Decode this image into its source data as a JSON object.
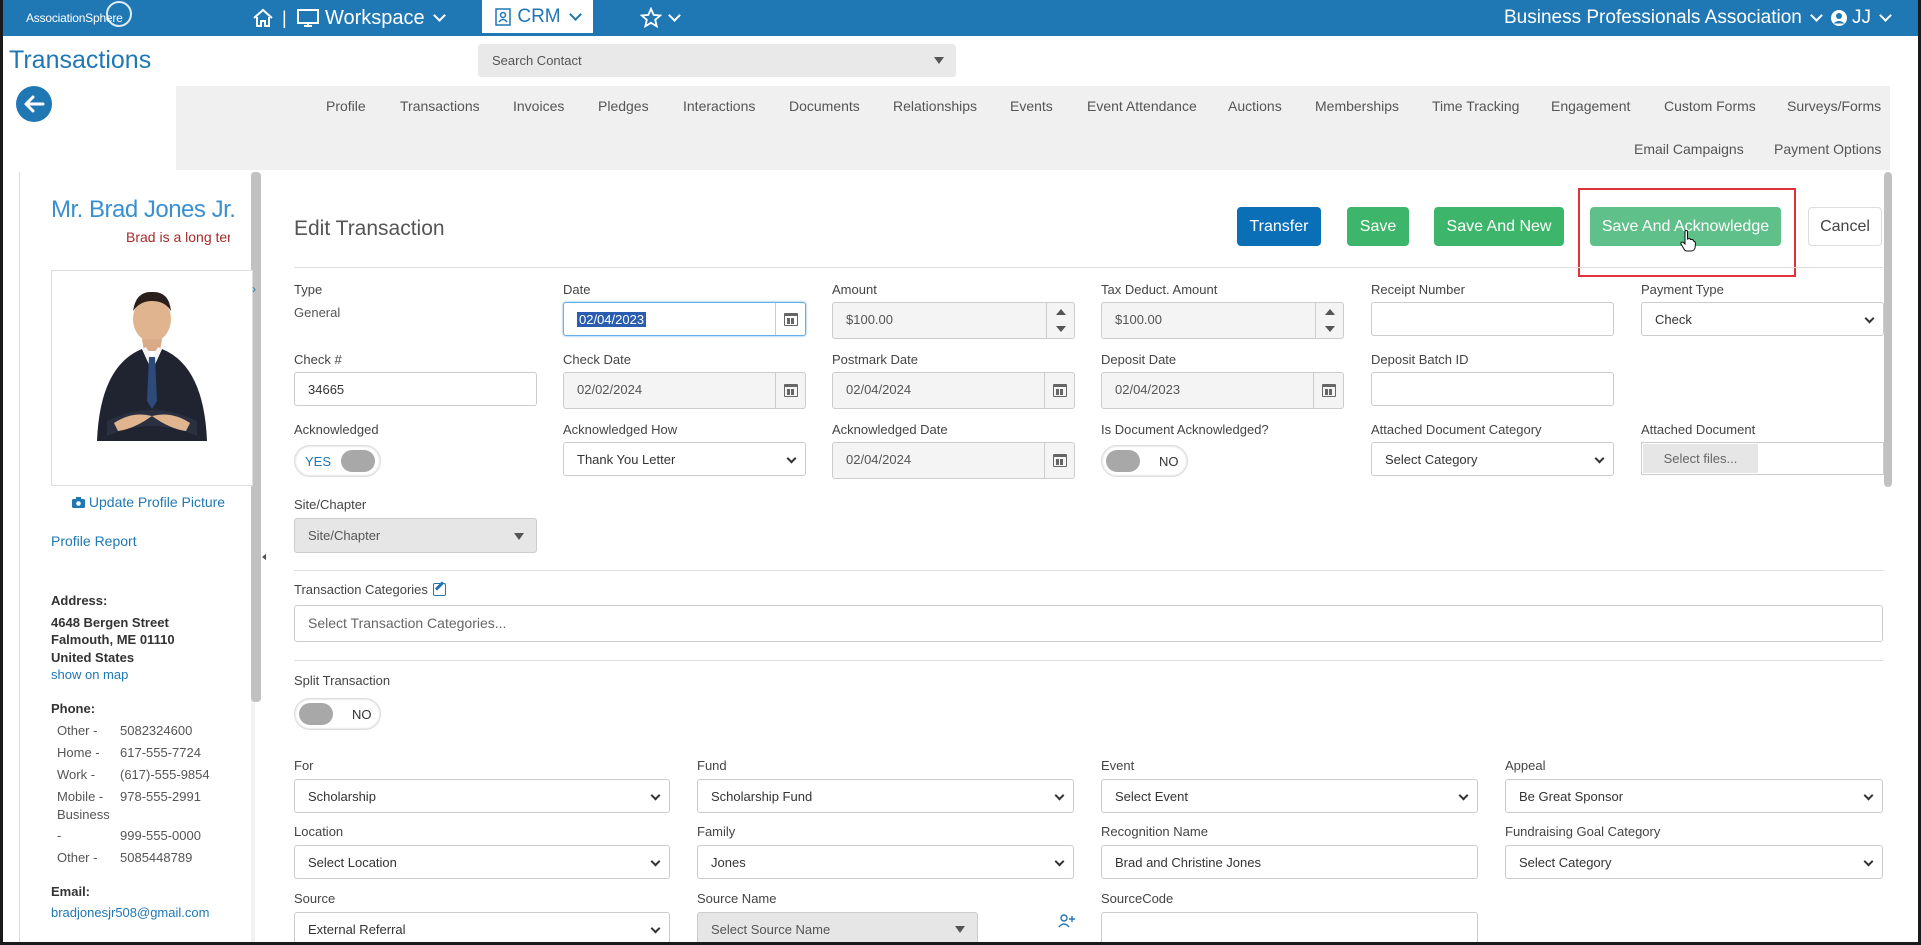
{
  "topbar": {
    "logo_text": "AssociationSphere",
    "workspace_label": "Workspace",
    "crm_label": "CRM",
    "org_name": "Business Professionals Association",
    "user_initials": "JJ"
  },
  "page": {
    "title": "Transactions",
    "search_placeholder": "Search Contact"
  },
  "tabs": [
    "Profile",
    "Transactions",
    "Invoices",
    "Pledges",
    "Interactions",
    "Documents",
    "Relationships",
    "Events",
    "Event Attendance",
    "Auctions",
    "Memberships",
    "Time Tracking",
    "Engagement",
    "Custom Forms",
    "Surveys/Forms",
    "Email Campaigns",
    "Payment Options"
  ],
  "profile": {
    "name": "Mr. Brad Jones Jr.",
    "note": "Brad is a long ter",
    "update_picture": "Update Profile Picture",
    "profile_report": "Profile Report",
    "address_label": "Address:",
    "address_line1": "4648 Bergen Street",
    "address_line2": "Falmouth, ME 01110",
    "address_line3": "United States",
    "show_on_map": "show on map",
    "phone_label": "Phone:",
    "phones": [
      {
        "type": "Other -",
        "number": "5082324600"
      },
      {
        "type": "Home -",
        "number": "617-555-7724"
      },
      {
        "type": "Work -",
        "number": "(617)-555-9854"
      },
      {
        "type": "Mobile -",
        "number": "978-555-2991"
      },
      {
        "type": "Business",
        "number": ""
      },
      {
        "type": "-",
        "number": "999-555-0000"
      },
      {
        "type": "Other -",
        "number": "5085448789"
      }
    ],
    "email_label": "Email:",
    "email": "bradjonesjr508@gmail.com"
  },
  "form": {
    "title": "Edit Transaction",
    "buttons": {
      "transfer": "Transfer",
      "save": "Save",
      "save_and_new": "Save And New",
      "save_and_acknowledge": "Save And Acknowledge",
      "cancel": "Cancel"
    },
    "type_label": "Type",
    "type_value": "General",
    "date_label": "Date",
    "date_value": "02/04/2023",
    "amount_label": "Amount",
    "amount_value": "$100.00",
    "tax_label": "Tax Deduct. Amount",
    "tax_value": "$100.00",
    "receipt_label": "Receipt Number",
    "receipt_value": "",
    "payment_type_label": "Payment Type",
    "payment_type_value": "Check",
    "check_no_label": "Check #",
    "check_no_value": "34665",
    "check_date_label": "Check Date",
    "check_date_value": "02/02/2024",
    "postmark_label": "Postmark Date",
    "postmark_value": "02/04/2024",
    "deposit_date_label": "Deposit Date",
    "deposit_date_value": "02/04/2023",
    "deposit_batch_label": "Deposit Batch ID",
    "deposit_batch_value": "",
    "acknowledged_label": "Acknowledged",
    "acknowledged_value": "YES",
    "ack_how_label": "Acknowledged How",
    "ack_how_value": "Thank You Letter",
    "ack_date_label": "Acknowledged Date",
    "ack_date_value": "02/04/2024",
    "is_doc_ack_label": "Is Document Acknowledged?",
    "is_doc_ack_value": "NO",
    "attached_cat_label": "Attached Document Category",
    "attached_cat_value": "Select Category",
    "attached_doc_label": "Attached Document",
    "attached_doc_button": "Select files...",
    "site_label": "Site/Chapter",
    "site_value": "Site/Chapter",
    "trans_cat_label": "Transaction Categories",
    "trans_cat_placeholder": "Select Transaction Categories...",
    "split_label": "Split Transaction",
    "split_value": "NO",
    "for_label": "For",
    "for_value": "Scholarship",
    "fund_label": "Fund",
    "fund_value": "Scholarship Fund",
    "event_label": "Event",
    "event_value": "Select Event",
    "appeal_label": "Appeal",
    "appeal_value": "Be Great Sponsor",
    "location_label": "Location",
    "location_value": "Select Location",
    "family_label": "Family",
    "family_value": "Jones",
    "recognition_label": "Recognition Name",
    "recognition_value": "Brad and Christine Jones",
    "goal_cat_label": "Fundraising Goal Category",
    "goal_cat_value": "Select Category",
    "source_label": "Source",
    "source_value": "External Referral",
    "source_name_label": "Source Name",
    "source_name_value": "Select Source Name",
    "source_code_label": "SourceCode",
    "source_code_value": ""
  },
  "colors": {
    "brand_blue": "#1f77b4",
    "button_blue": "#0b6fb8",
    "button_green": "#3db66b",
    "highlight_red": "#e0323a"
  }
}
